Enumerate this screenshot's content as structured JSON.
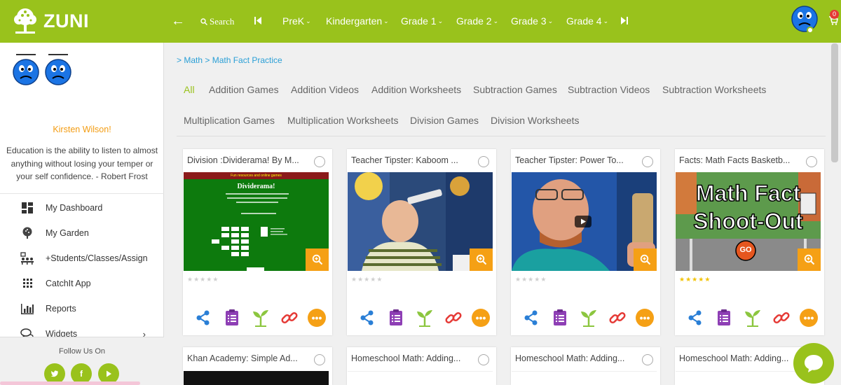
{
  "app": {
    "logo_text": "ZUNI"
  },
  "nav": {
    "search_label": "Search",
    "items": [
      "PreK",
      "Kindergarten",
      "Grade 1",
      "Grade 2",
      "Grade 3",
      "Grade 4"
    ],
    "cart_count": "0"
  },
  "sidebar": {
    "user_name": "Kirsten Wilson!",
    "quote": "Education is the ability to listen to almost anything without losing your temper or your self confidence. - Robert Frost",
    "menu": [
      {
        "label": "My Dashboard",
        "icon": "dashboard-icon"
      },
      {
        "label": "My Garden",
        "icon": "tree-icon"
      },
      {
        "label": "+Students/Classes/Assign",
        "icon": "classroom-icon"
      },
      {
        "label": "CatchIt App",
        "icon": "apps-grid-icon"
      },
      {
        "label": "Reports",
        "icon": "bar-chart-icon"
      },
      {
        "label": "Widgets",
        "icon": "chat-bubbles-icon"
      }
    ],
    "follow_label": "Follow Us On",
    "social": [
      "twitter-icon",
      "facebook-icon",
      "youtube-icon"
    ]
  },
  "breadcrumb": "> Math > Math Fact Practice",
  "filters": {
    "row1": [
      "All",
      "Addition Games",
      "Addition Videos",
      "Addition Worksheets",
      "Subtraction Games",
      "Subtraction Videos",
      "Subtraction Worksheets"
    ],
    "row2": [
      "Multiplication Games",
      "Multiplication Worksheets",
      "Division Games",
      "Division Worksheets"
    ],
    "active": "All"
  },
  "cards": [
    {
      "title": "Division :Dividerama! By M...",
      "rating": 0,
      "thumb_title": "Dividerama!",
      "thumb_sub": "Fun resources and online games"
    },
    {
      "title": "Teacher Tipster: Kaboom ...",
      "rating": 0
    },
    {
      "title": "Teacher Tipster: Power To...",
      "rating": 0
    },
    {
      "title": "Facts: Math Facts Basketb...",
      "rating": 5,
      "thumb_title_1": "Math Fact",
      "thumb_title_2": "Shoot-Out",
      "thumb_button": "GO"
    },
    {
      "title": "Khan Academy: Simple Ad..."
    },
    {
      "title": "Homeschool Math: Adding..."
    },
    {
      "title": "Homeschool Math: Adding..."
    },
    {
      "title": "Homeschool Math: Adding..."
    }
  ],
  "colors": {
    "brand_green": "#99c21c",
    "accent_orange": "#f5a015",
    "link_blue": "#2a9fd6",
    "star_gold": "#f2c200"
  }
}
